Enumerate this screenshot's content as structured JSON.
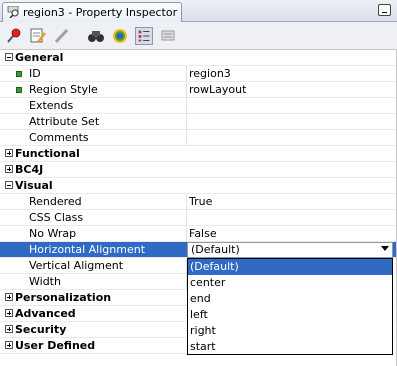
{
  "window": {
    "title": "region3 - Property Inspector"
  },
  "toolbar": {
    "icons": [
      "pin-icon",
      "edit-properties-icon",
      "pencil-icon",
      "find-icon",
      "color-sync-icon",
      "categories-view-icon",
      "tab-view-icon"
    ]
  },
  "sections": {
    "general": "General",
    "functional": "Functional",
    "bc4j": "BC4J",
    "visual": "Visual",
    "personalization": "Personalization",
    "advanced": "Advanced",
    "security": "Security",
    "user_defined": "User Defined"
  },
  "properties": {
    "id": {
      "name": "ID",
      "value": "region3"
    },
    "region_style": {
      "name": "Region Style",
      "value": "rowLayout"
    },
    "extends": {
      "name": "Extends",
      "value": ""
    },
    "attribute_set": {
      "name": "Attribute Set",
      "value": ""
    },
    "comments": {
      "name": "Comments",
      "value": ""
    },
    "rendered": {
      "name": "Rendered",
      "value": "True"
    },
    "css_class": {
      "name": "CSS Class",
      "value": ""
    },
    "no_wrap": {
      "name": "No Wrap",
      "value": "False"
    },
    "horizontal_alignment": {
      "name": "Horizontal Alignment",
      "value": "(Default)"
    },
    "vertical_alignment": {
      "name": "Vertical Aligment",
      "value": ""
    },
    "width": {
      "name": "Width",
      "value": ""
    }
  },
  "dropdown": {
    "options": [
      "(Default)",
      "center",
      "end",
      "left",
      "right",
      "start"
    ],
    "selected": "(Default)"
  },
  "colors": {
    "selection": "#316ac5",
    "bullet": "#3a9a3a"
  }
}
